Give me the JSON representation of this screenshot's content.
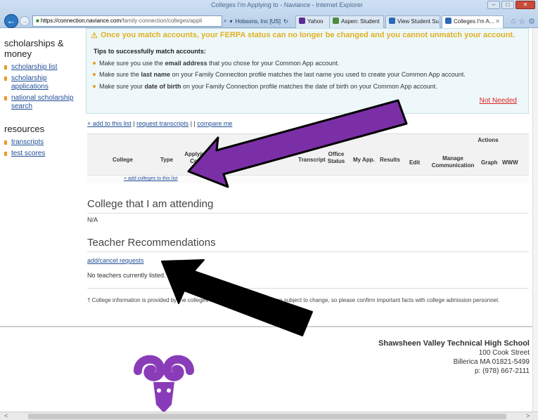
{
  "browser": {
    "window_title": "Colleges I'm Applying to - Naviance - Internet Explorer",
    "url_host": "https://connection.naviance.com",
    "url_path": "/family-connection/colleges/appli",
    "site_identity": "Hobsons, Inc [US]",
    "tabs": [
      {
        "label": "Yahoo",
        "color": "#5b2d91",
        "active": false
      },
      {
        "label": "Aspen: Student",
        "color": "#4c8a3a",
        "active": false
      },
      {
        "label": "View Student Su...",
        "color": "#2a6ab3",
        "active": false
      },
      {
        "label": "Colleges I'm A...",
        "color": "#2a6ab3",
        "active": true
      }
    ]
  },
  "sidebar": {
    "section1_title": "scholarships & money",
    "section1_items": [
      "scholarship list",
      "scholarship applications",
      "national scholarship search"
    ],
    "section2_title": "resources",
    "section2_items": [
      "transcripts",
      "test scores"
    ]
  },
  "ferpa": {
    "warning": "Once you match accounts, your FERPA status can no longer be changed and you cannot unmatch your account.",
    "tips_title": "Tips to successfully match accounts:",
    "tip1_pre": "Make sure you use the ",
    "tip1_bold": "email address",
    "tip1_post": " that you chose for your Common App account.",
    "tip2_pre": "Make sure the ",
    "tip2_bold": "last name",
    "tip2_post": " on your Family Connection profile matches the last name you used to create your Common App account.",
    "tip3_pre": "Make sure your ",
    "tip3_bold": "date of birth",
    "tip3_post": " on your Family Connection profile matches the date of birth on your Common App account.",
    "not_needed": "Not Needed"
  },
  "list_links": {
    "add": "+ add to this list",
    "request": "request transcripts",
    "sep": "| |",
    "compare": "compare me"
  },
  "table": {
    "actions_header": "Actions",
    "columns": [
      "College",
      "Type",
      "Applying via Comm...",
      "Transcript",
      "Office Status",
      "My App.",
      "Results",
      "Edit",
      "Manage Communication",
      "Graph",
      "WWW"
    ],
    "add_colleges": "+ add colleges to this list"
  },
  "attending": {
    "title": "College that I am attending",
    "value": "N/A"
  },
  "teacher_recs": {
    "title": "Teacher Recommendations",
    "link": "add/cancel requests",
    "empty": "No teachers currently listed."
  },
  "footnote": "† College information is provided by the colleges ... policies, and programs are subject to change, so please confirm important facts with college admission personnel.",
  "school": {
    "name": "Shawsheen Valley Technical High School",
    "street": "100 Cook Street",
    "city": "Billerica MA 01821-5499",
    "phone": "p: (978) 667-2111"
  },
  "colors": {
    "link": "#1f4e96",
    "warning": "#e0b021",
    "not_needed": "#dd2222",
    "arrow_purple": "#7b2fa6",
    "arrow_black": "#000000",
    "ram_purple": "#8a3cb8"
  }
}
